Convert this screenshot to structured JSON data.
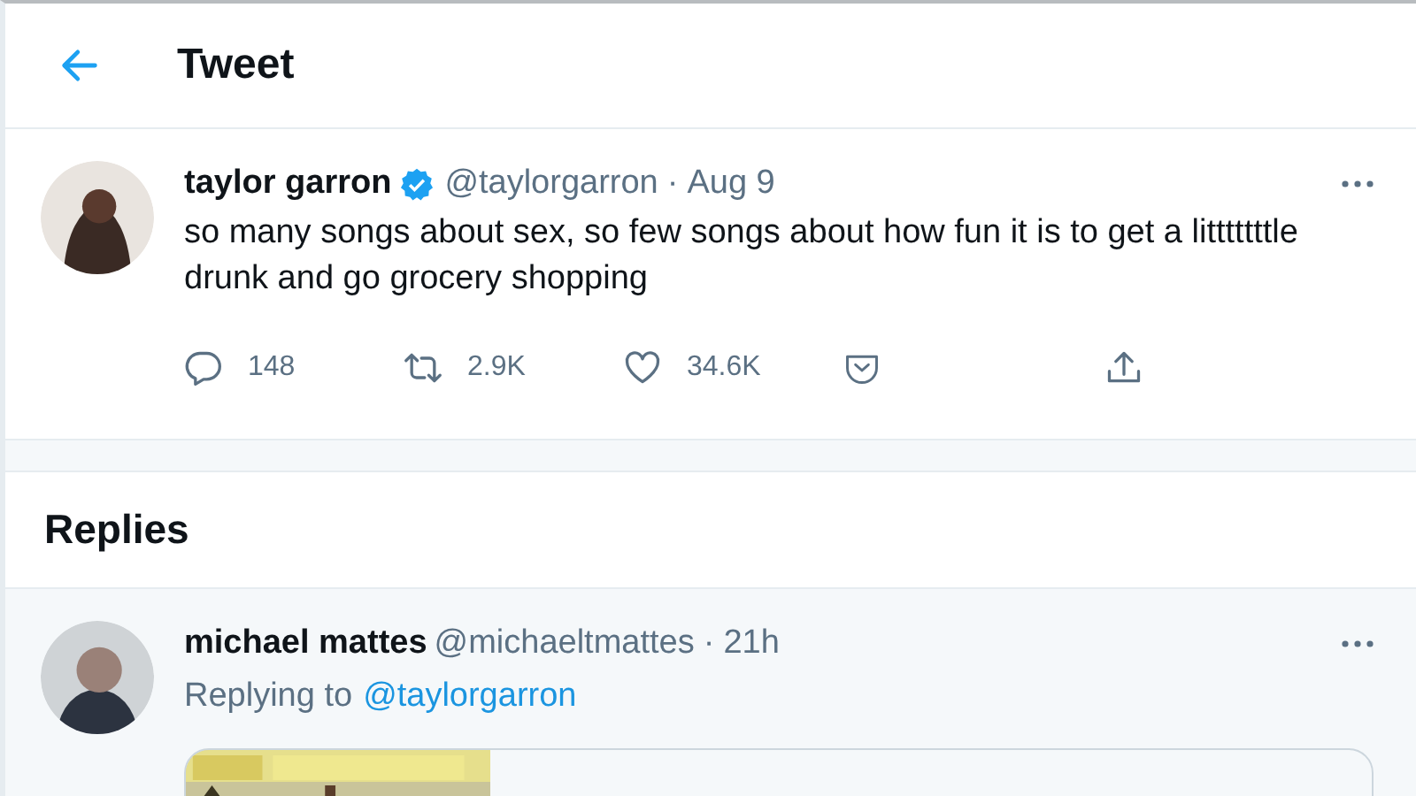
{
  "header": {
    "title": "Tweet"
  },
  "tweet": {
    "name": "taylor garron",
    "verified": true,
    "handle": "@taylorgarron",
    "separator": "·",
    "date": "Aug 9",
    "text": "so many songs about sex, so few songs about how fun it is to get a litttttttle drunk and go grocery shopping",
    "stats": [
      {
        "kind": "reply",
        "count": "148"
      },
      {
        "kind": "retweet",
        "count": "2.9K"
      },
      {
        "kind": "like",
        "count": "34.6K"
      },
      {
        "kind": "react"
      },
      {
        "kind": "share"
      }
    ]
  },
  "replies": {
    "title": "Replies",
    "items": [
      {
        "name": "michael mattes",
        "handle": "@michaeltmattes",
        "separator": "·",
        "time": "21h",
        "replying_prefix": "Replying to",
        "replying_to": "@taylorgarron"
      }
    ]
  }
}
